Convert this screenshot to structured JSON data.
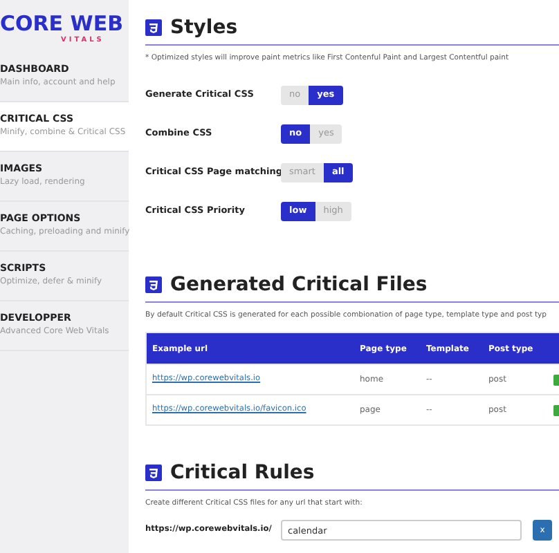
{
  "logo": {
    "title": "CORE WEB",
    "subtitle": "VITALS"
  },
  "sidebar": {
    "items": [
      {
        "title": "DASHBOARD",
        "subtitle": "Main info, account and help",
        "selected": false
      },
      {
        "title": "CRITICAL CSS",
        "subtitle": "Minify, combine & Critical CSS",
        "selected": true
      },
      {
        "title": "IMAGES",
        "subtitle": "Lazy load, rendering",
        "selected": false
      },
      {
        "title": "PAGE OPTIONS",
        "subtitle": "Caching, preloading and minify",
        "selected": false
      },
      {
        "title": "SCRIPTS",
        "subtitle": "Optimize, defer & minify",
        "selected": false
      },
      {
        "title": "DEVELOPPER",
        "subtitle": "Advanced Core Web Vitals",
        "selected": false
      }
    ]
  },
  "styles": {
    "title": "Styles",
    "note": "* Optimized styles will improve paint metrics like First Contenful Paint and Largest Contentful paint",
    "settings": [
      {
        "label": "Generate Critical CSS",
        "options": [
          {
            "label": "no",
            "selected": false
          },
          {
            "label": "yes",
            "selected": true
          }
        ]
      },
      {
        "label": "Combine CSS",
        "options": [
          {
            "label": "no",
            "selected": true
          },
          {
            "label": "yes",
            "selected": false
          }
        ]
      },
      {
        "label": "Critical CSS Page matching",
        "options": [
          {
            "label": "smart",
            "selected": false
          },
          {
            "label": "all",
            "selected": true
          }
        ]
      },
      {
        "label": "Critical CSS Priority",
        "options": [
          {
            "label": "low",
            "selected": true
          },
          {
            "label": "high",
            "selected": false
          }
        ]
      }
    ]
  },
  "generated": {
    "title": "Generated Critical Files",
    "note": "By default Critical CSS is generated for each possible combionation of page type, template type and post typ",
    "table": {
      "columns": [
        "Example url",
        "Page type",
        "Template",
        "Post type"
      ],
      "rows": [
        {
          "url": "https://wp.corewebvitals.io",
          "page_type": "home",
          "template": "--",
          "post_type": "post"
        },
        {
          "url": "https://wp.corewebvitals.io/favicon.ico",
          "page_type": "page",
          "template": "--",
          "post_type": "post"
        }
      ]
    }
  },
  "rules": {
    "title": "Critical Rules",
    "note": "Create different Critical CSS files for any url that start with:",
    "prefix": "https://wp.corewebvitals.io/",
    "value": "calendar",
    "button": "x"
  }
}
